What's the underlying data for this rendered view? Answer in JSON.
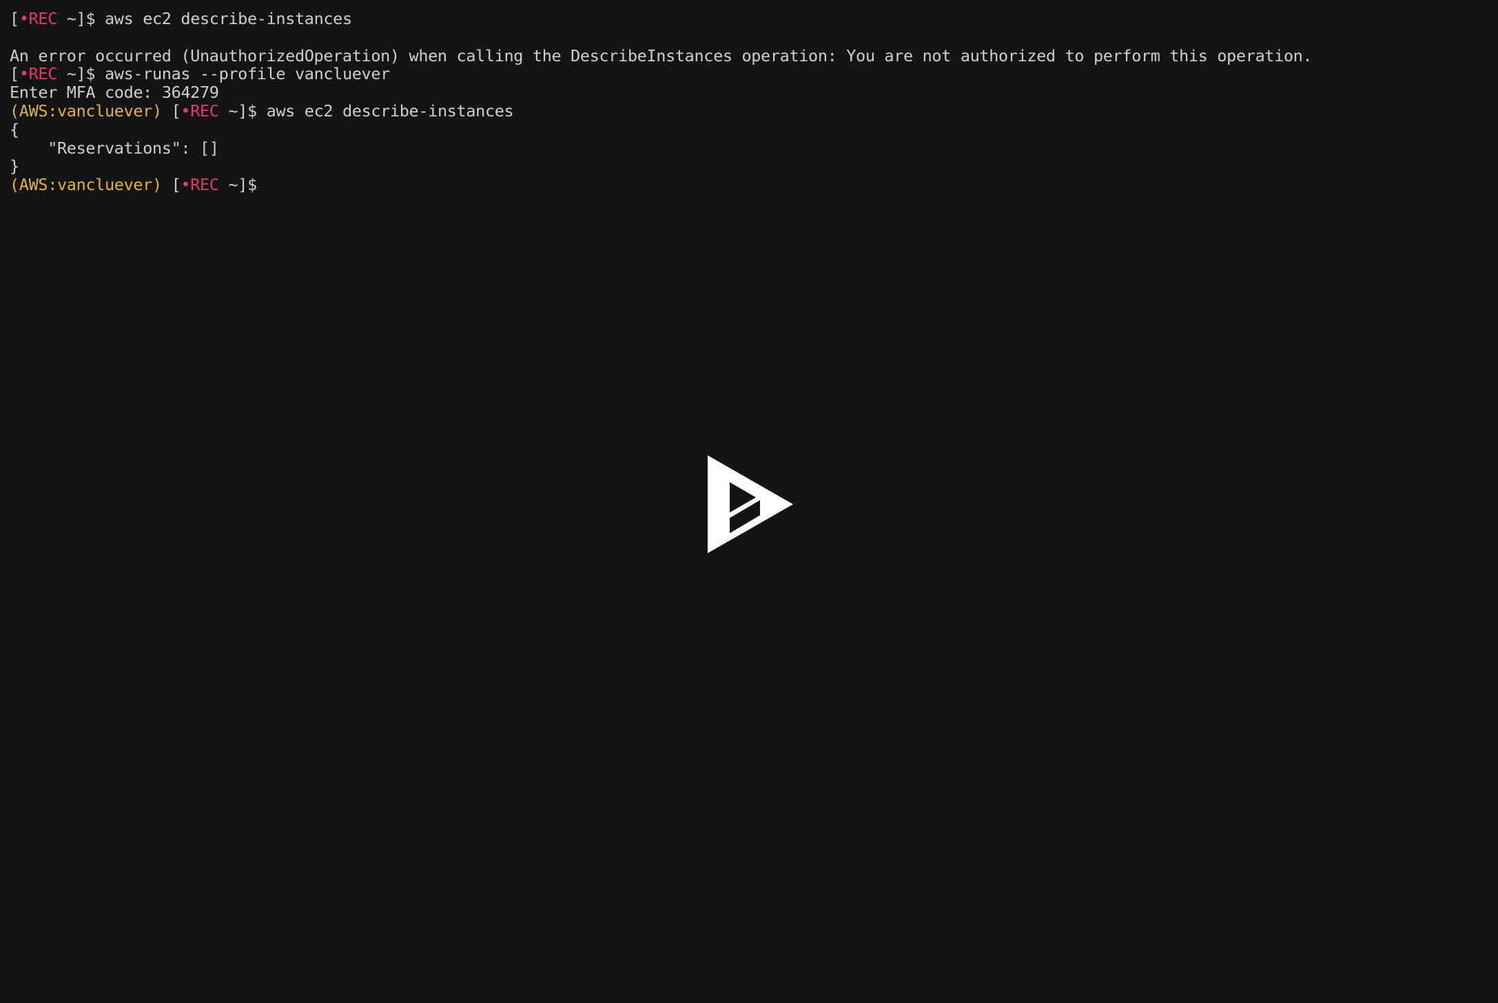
{
  "player": {
    "name": "asciinema-player",
    "background_color": "#141416",
    "foreground_color": "#cfcfcf",
    "accent_rec_color": "#e23b62",
    "accent_aws_color": "#e0b33c",
    "play_button_color": "#ffffff",
    "play_button_label": "Play"
  },
  "terminal": {
    "lines": [
      {
        "id": "line-prompt-1",
        "segments": [
          {
            "text": "[",
            "color": "default"
          },
          {
            "text": "•REC",
            "color": "rec"
          },
          {
            "text": " ~]$ aws ec2 describe-instances",
            "color": "default"
          }
        ]
      },
      {
        "id": "line-blank-1",
        "segments": [
          {
            "text": "",
            "color": "default"
          }
        ]
      },
      {
        "id": "line-error",
        "segments": [
          {
            "text": "An error occurred (UnauthorizedOperation) when calling the DescribeInstances operation: You are not authorized to perform this operation.",
            "color": "default"
          }
        ]
      },
      {
        "id": "line-prompt-2",
        "segments": [
          {
            "text": "[",
            "color": "default"
          },
          {
            "text": "•REC",
            "color": "rec"
          },
          {
            "text": " ~]$ aws-runas --profile vancluever",
            "color": "default"
          }
        ]
      },
      {
        "id": "line-mfa",
        "segments": [
          {
            "text": "Enter MFA code: 364279",
            "color": "default"
          }
        ]
      },
      {
        "id": "line-prompt-3",
        "segments": [
          {
            "text": "(AWS:vancluever)",
            "color": "aws"
          },
          {
            "text": " [",
            "color": "default"
          },
          {
            "text": "•REC",
            "color": "rec"
          },
          {
            "text": " ~]$ aws ec2 describe-instances",
            "color": "default"
          }
        ]
      },
      {
        "id": "line-json-open",
        "segments": [
          {
            "text": "{",
            "color": "default"
          }
        ]
      },
      {
        "id": "line-json-reservations",
        "segments": [
          {
            "text": "    \"Reservations\": []",
            "color": "default"
          }
        ]
      },
      {
        "id": "line-json-close",
        "segments": [
          {
            "text": "}",
            "color": "default"
          }
        ]
      },
      {
        "id": "line-prompt-4",
        "segments": [
          {
            "text": "(AWS:vancluever)",
            "color": "aws"
          },
          {
            "text": " [",
            "color": "default"
          },
          {
            "text": "•REC",
            "color": "rec"
          },
          {
            "text": " ~]$",
            "color": "default"
          }
        ]
      }
    ]
  }
}
